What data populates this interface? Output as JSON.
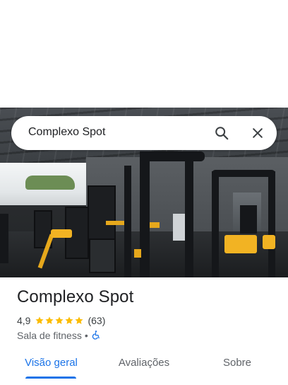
{
  "search": {
    "query": "Complexo Spot",
    "search_icon": "search-icon",
    "clear_icon": "close-icon"
  },
  "photo": {
    "subject": "gym interior"
  },
  "place": {
    "name": "Complexo Spot",
    "rating": "4,9",
    "stars": 5,
    "review_count": "(63)",
    "category": "Sala de fitness",
    "separator": "•",
    "accessibility_icon": "wheelchair-icon"
  },
  "tabs": [
    {
      "label": "Visão geral",
      "active": true
    },
    {
      "label": "Avaliações",
      "active": false
    },
    {
      "label": "Sobre",
      "active": false
    }
  ],
  "colors": {
    "accent": "#1a73e8",
    "star": "#fbbc04",
    "text_primary": "#202124",
    "text_secondary": "#5f6368"
  }
}
